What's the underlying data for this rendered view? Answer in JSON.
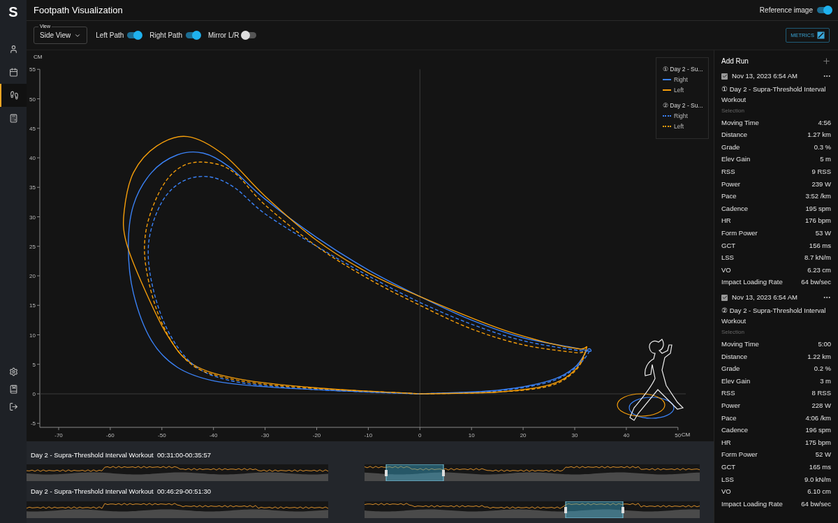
{
  "sidebar": {
    "logo": "S",
    "items": [
      {
        "selected": false
      },
      {
        "selected": false
      },
      {
        "selected": true
      },
      {
        "selected": false
      }
    ]
  },
  "header": {
    "title": "Footpath Visualization",
    "reference_toggle": {
      "label": "Reference image",
      "on": true
    }
  },
  "toolbar": {
    "view": {
      "label": "View",
      "value": "Side View"
    },
    "toggles": [
      {
        "label": "Left Path",
        "on": true
      },
      {
        "label": "Right Path",
        "on": true
      },
      {
        "label": "Mirror L/R",
        "on": false
      }
    ],
    "metrics_button": "METRICS"
  },
  "chart": {
    "y_unit": "CM",
    "x_unit": "CM",
    "y_ticks": [
      "55",
      "50",
      "45",
      "40",
      "35",
      "30",
      "25",
      "20",
      "15",
      "10",
      "5",
      "0",
      "-5"
    ],
    "x_ticks": [
      "-70",
      "-60",
      "-50",
      "-40",
      "-30",
      "-20",
      "-10",
      "0",
      "10",
      "20",
      "30",
      "40",
      "50"
    ],
    "legend": [
      {
        "title": "① Day 2 - Su...",
        "entries": [
          {
            "label": "Right",
            "color": "#3b82f6",
            "dashed": false
          },
          {
            "label": "Left",
            "color": "#f59e0b",
            "dashed": false
          }
        ]
      },
      {
        "title": "② Day 2 - Su...",
        "entries": [
          {
            "label": "Right",
            "color": "#3b82f6",
            "dashed": true
          },
          {
            "label": "Left",
            "color": "#f59e0b",
            "dashed": true
          }
        ]
      }
    ]
  },
  "timelines": [
    {
      "title": "Day 2 - Supra-Threshold Interval Workout",
      "range": "00:31:00-00:35:57"
    },
    {
      "title": "Day 2 - Supra-Threshold Interval Workout",
      "range": "00:46:29-00:51:30"
    }
  ],
  "panel": {
    "add_run": "Add Run",
    "runs": [
      {
        "checked": true,
        "date": "Nov 13, 2023 6:54 AM",
        "title": "① Day 2 - Supra-Threshold Interval Workout",
        "selection_label": "Selection",
        "metrics": [
          [
            "Moving Time",
            "4:56"
          ],
          [
            "Distance",
            "1.27 km"
          ],
          [
            "Grade",
            "0.3 %"
          ],
          [
            "Elev Gain",
            "5 m"
          ],
          [
            "RSS",
            "9 RSS"
          ],
          [
            "Power",
            "239 W"
          ],
          [
            "Pace",
            "3:52 /km"
          ],
          [
            "Cadence",
            "195 spm"
          ],
          [
            "HR",
            "176 bpm"
          ],
          [
            "Form Power",
            "53 W"
          ],
          [
            "GCT",
            "156 ms"
          ],
          [
            "LSS",
            "8.7 kN/m"
          ],
          [
            "VO",
            "6.23 cm"
          ],
          [
            "Impact Loading Rate",
            "64 bw/sec"
          ]
        ]
      },
      {
        "checked": true,
        "date": "Nov 13, 2023 6:54 AM",
        "title": "② Day 2 - Supra-Threshold Interval Workout",
        "selection_label": "Selection",
        "metrics": [
          [
            "Moving Time",
            "5:00"
          ],
          [
            "Distance",
            "1.22 km"
          ],
          [
            "Grade",
            "0.2 %"
          ],
          [
            "Elev Gain",
            "3 m"
          ],
          [
            "RSS",
            "8 RSS"
          ],
          [
            "Power",
            "228 W"
          ],
          [
            "Pace",
            "4:06 /km"
          ],
          [
            "Cadence",
            "196 spm"
          ],
          [
            "HR",
            "175 bpm"
          ],
          [
            "Form Power",
            "52 W"
          ],
          [
            "GCT",
            "165 ms"
          ],
          [
            "LSS",
            "9.0 kN/m"
          ],
          [
            "VO",
            "6.10 cm"
          ],
          [
            "Impact Loading Rate",
            "64 bw/sec"
          ]
        ]
      }
    ]
  }
}
